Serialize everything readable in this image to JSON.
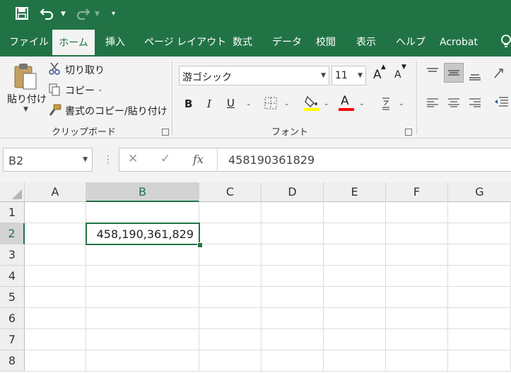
{
  "qat": {
    "save_icon": "save-icon",
    "undo_icon": "undo-icon",
    "redo_icon": "redo-icon"
  },
  "tabs": [
    {
      "label": "ファイル"
    },
    {
      "label": "ホーム",
      "active": true
    },
    {
      "label": "挿入"
    },
    {
      "label": "ページ レイアウト"
    },
    {
      "label": "数式"
    },
    {
      "label": "データ"
    },
    {
      "label": "校閲"
    },
    {
      "label": "表示"
    },
    {
      "label": "ヘルプ"
    },
    {
      "label": "Acrobat"
    }
  ],
  "clipboard": {
    "paste_label": "貼り付け",
    "cut_label": "切り取り",
    "copy_label": "コピー",
    "format_painter_label": "書式のコピー/貼り付け",
    "group_label": "クリップボード"
  },
  "font": {
    "font_name": "游ゴシック",
    "font_size": "11",
    "bold": "B",
    "italic": "I",
    "underline": "U",
    "font_color_glyph": "A",
    "grow_glyph": "A",
    "shrink_glyph": "A",
    "group_label": "フォント",
    "fill_color": "#ffff00",
    "font_color": "#ff0000"
  },
  "formula_bar": {
    "name_box": "B2",
    "fx": "fx",
    "cancel": "✕",
    "enter": "✓",
    "content": "458190361829"
  },
  "grid": {
    "columns": [
      "A",
      "B",
      "C",
      "D",
      "E",
      "F",
      "G"
    ],
    "rows": [
      "1",
      "2",
      "3",
      "4",
      "5",
      "6",
      "7",
      "8"
    ],
    "selected_cell": "B2",
    "b2_value": "458,190,361,829"
  },
  "colors": {
    "accent": "#217346"
  }
}
